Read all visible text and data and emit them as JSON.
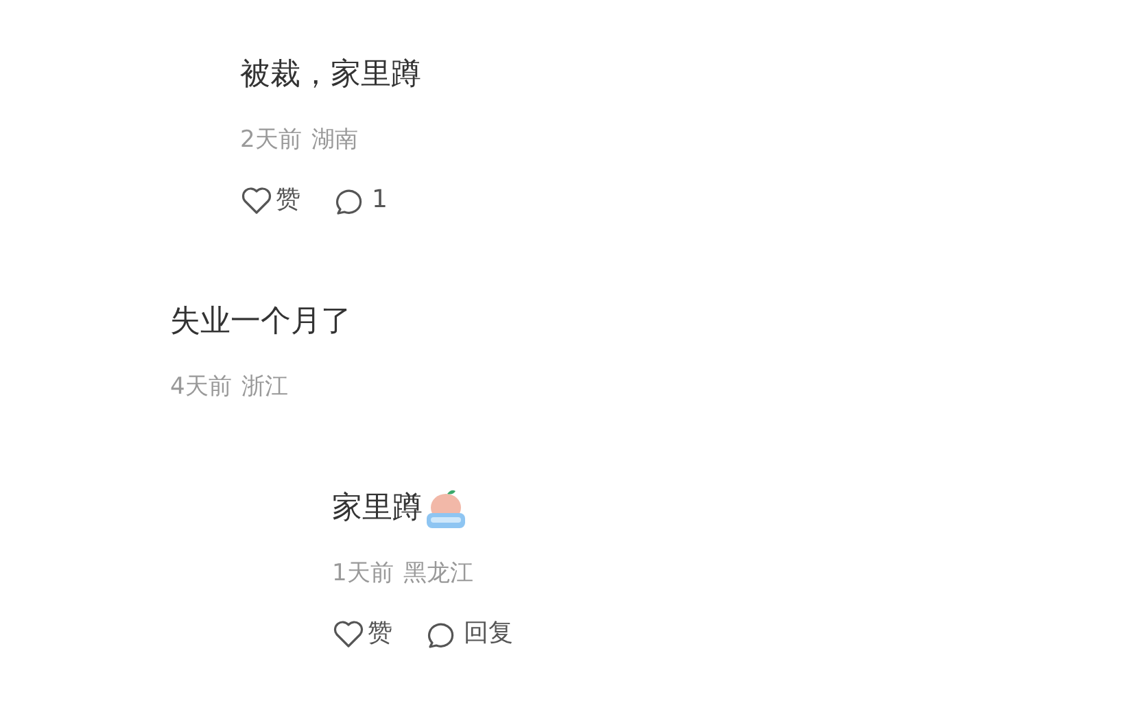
{
  "comments": [
    {
      "kind": "sub_reply",
      "text": "被裁，家里蹲",
      "sticker": false,
      "time": "2天前",
      "region": "湖南",
      "actions": {
        "like": "赞",
        "reply": "1"
      }
    },
    {
      "kind": "comment",
      "text": "失业一个月了",
      "sticker": false,
      "time": "4天前",
      "region": "浙江"
    },
    {
      "kind": "reply",
      "text": "家里蹲",
      "sticker": true,
      "time": "1天前",
      "region": "黑龙江",
      "actions": {
        "like": "赞",
        "reply": "回复"
      }
    }
  ]
}
